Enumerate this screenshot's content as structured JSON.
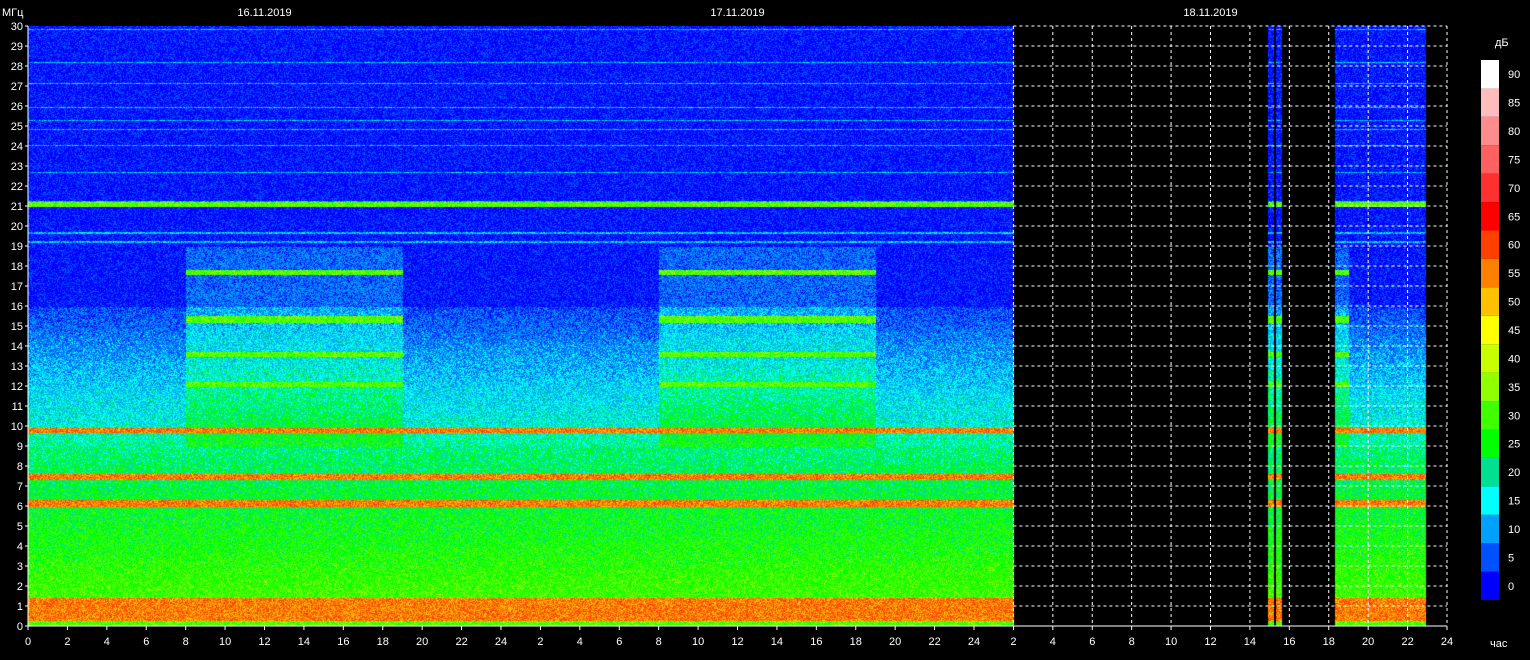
{
  "chart_data": {
    "type": "heatmap",
    "ylabel": "МГц",
    "xlabel": "час",
    "colorbar_label": "дБ",
    "ylim": [
      0,
      30
    ],
    "yticks": [
      0,
      1,
      2,
      3,
      4,
      5,
      6,
      7,
      8,
      9,
      10,
      11,
      12,
      13,
      14,
      15,
      16,
      17,
      18,
      19,
      20,
      21,
      22,
      23,
      24,
      25,
      26,
      27,
      28,
      29,
      30
    ],
    "x_total_hours": 72,
    "xtick_labels": [
      "0",
      "2",
      "4",
      "6",
      "8",
      "10",
      "12",
      "14",
      "16",
      "18",
      "20",
      "22",
      "24",
      "2",
      "4",
      "6",
      "8",
      "10",
      "12",
      "14",
      "16",
      "18",
      "20",
      "22",
      "24",
      "2",
      "4",
      "6",
      "8",
      "10",
      "12",
      "14",
      "16",
      "18",
      "20",
      "22",
      "24"
    ],
    "dates": [
      {
        "label": "16.11.2019",
        "hour": 12
      },
      {
        "label": "17.11.2019",
        "hour": 36
      },
      {
        "label": "18.11.2019",
        "hour": 60
      }
    ],
    "no_data_intervals_h": [
      [
        50,
        62.9
      ],
      [
        63.2,
        63.3
      ],
      [
        63.6,
        66.3
      ],
      [
        70.9,
        72
      ]
    ],
    "colorscale": {
      "levels": [
        0,
        5,
        10,
        15,
        20,
        25,
        30,
        35,
        40,
        45,
        50,
        55,
        60,
        65,
        70,
        75,
        80,
        85,
        90
      ],
      "colors": [
        "#0000ff",
        "#0050ff",
        "#00a0ff",
        "#00ffff",
        "#00e090",
        "#00ff00",
        "#40ff00",
        "#90ff00",
        "#c8ff00",
        "#ffff00",
        "#ffc000",
        "#ff8000",
        "#ff4000",
        "#ff0000",
        "#ff3030",
        "#ff6060",
        "#ff8c8c",
        "#ffbcbc",
        "#ffffff"
      ]
    }
  }
}
